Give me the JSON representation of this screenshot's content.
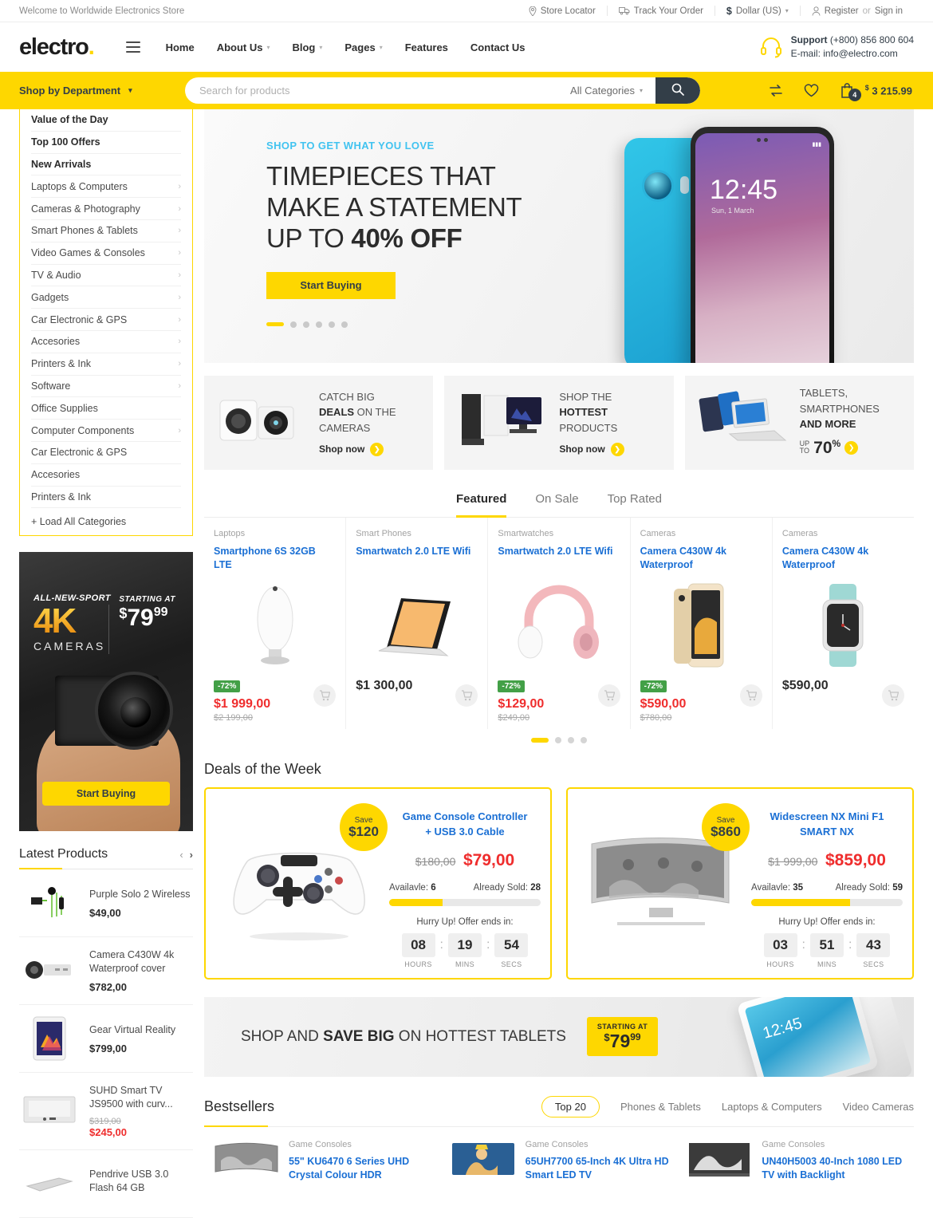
{
  "topbar": {
    "welcome": "Welcome to Worldwide Electronics Store",
    "store_locator": "Store Locator",
    "track_order": "Track Your Order",
    "currency": "Dollar (US)",
    "currency_symbol": "$",
    "register": "Register",
    "or": "or",
    "signin": "Sign in"
  },
  "header": {
    "logo": "electro",
    "logo_dot": ".",
    "nav": [
      {
        "label": "Home",
        "caret": false
      },
      {
        "label": "About Us",
        "caret": true
      },
      {
        "label": "Blog",
        "caret": true
      },
      {
        "label": "Pages",
        "caret": true
      },
      {
        "label": "Features",
        "caret": false
      },
      {
        "label": "Contact Us",
        "caret": false
      }
    ],
    "support_label": "Support",
    "support_phone": "(+800) 856 800 604",
    "support_email": "E-mail: info@electro.com"
  },
  "search": {
    "department": "Shop by Department",
    "placeholder": "Search for products",
    "value": "",
    "all_categories": "All Categories",
    "cart_count": "4",
    "cart_total": "3 215.99",
    "cart_currency": "$"
  },
  "sidebar": {
    "categories": [
      {
        "label": "Value of the Day",
        "bold": true,
        "arrow": false
      },
      {
        "label": "Top 100 Offers",
        "bold": true,
        "arrow": false
      },
      {
        "label": "New Arrivals",
        "bold": true,
        "arrow": false
      },
      {
        "label": "Laptops & Computers",
        "bold": false,
        "arrow": true
      },
      {
        "label": "Cameras & Photography",
        "bold": false,
        "arrow": true
      },
      {
        "label": "Smart Phones & Tablets",
        "bold": false,
        "arrow": true
      },
      {
        "label": "Video Games & Consoles",
        "bold": false,
        "arrow": true
      },
      {
        "label": "TV & Audio",
        "bold": false,
        "arrow": true
      },
      {
        "label": "Gadgets",
        "bold": false,
        "arrow": true
      },
      {
        "label": "Car Electronic & GPS",
        "bold": false,
        "arrow": true
      },
      {
        "label": "Accesories",
        "bold": false,
        "arrow": true
      },
      {
        "label": "Printers & Ink",
        "bold": false,
        "arrow": true
      },
      {
        "label": "Software",
        "bold": false,
        "arrow": true
      },
      {
        "label": "Office Supplies",
        "bold": false,
        "arrow": false
      },
      {
        "label": "Computer Components",
        "bold": false,
        "arrow": true
      },
      {
        "label": "Car Electronic & GPS",
        "bold": false,
        "arrow": false
      },
      {
        "label": "Accesories",
        "bold": false,
        "arrow": false
      },
      {
        "label": "Printers & Ink",
        "bold": false,
        "arrow": false
      }
    ],
    "load_all": "+ Load All Categories",
    "ad": {
      "eyebrow": "ALL-NEW-SPORT",
      "big": "4K",
      "sub": "CAMERAS",
      "starting_at": "STARTING AT",
      "currency": "$",
      "price": "79",
      "cents": "99",
      "button": "Start Buying"
    },
    "latest_title": "Latest Products",
    "latest": [
      {
        "name": "Purple Solo 2 Wireless",
        "price": "$49,00",
        "old": "",
        "sale": false,
        "icon": "earphones"
      },
      {
        "name": "Camera C430W 4k Waterproof cover",
        "price": "$782,00",
        "old": "",
        "sale": false,
        "icon": "camcorder"
      },
      {
        "name": "Gear Virtual Reality",
        "price": "$799,00",
        "old": "",
        "sale": false,
        "icon": "tablet"
      },
      {
        "name": "SUHD Smart TV JS9500 with curv...",
        "price": "$245,00",
        "old": "$319,00",
        "sale": true,
        "icon": "tv"
      },
      {
        "name": "Pendrive USB 3.0 Flash 64 GB",
        "price": "",
        "old": "",
        "sale": false,
        "icon": "usb"
      }
    ]
  },
  "hero": {
    "eyebrow": "SHOP TO GET WHAT YOU LOVE",
    "line1": "TIMEPIECES THAT",
    "line2": "MAKE A STATEMENT",
    "line3_plain": "UP TO ",
    "line3_bold": "40% OFF",
    "button": "Start Buying",
    "dots": 6,
    "active_dot": 0,
    "phone_time": "12:45",
    "phone_date": "Sun, 1 March"
  },
  "promos": [
    {
      "line1": "CATCH BIG",
      "line2_bold": "DEALS",
      "line2_rest": " ON THE",
      "line3": "CAMERAS",
      "cta": "Shop now",
      "type": "camera"
    },
    {
      "line1": "SHOP THE",
      "line2_bold": "HOTTEST",
      "line2_rest": "",
      "line3": "PRODUCTS",
      "cta": "Shop now",
      "type": "desktop"
    },
    {
      "line1": "TABLETS,",
      "line2_bold": "",
      "line2_rest": "SMARTPHONES",
      "line3": "AND MORE",
      "cta": "",
      "upto_label_1": "UP",
      "upto_label_2": "TO",
      "upto_value": "70",
      "upto_pct": "%",
      "type": "tablets"
    }
  ],
  "featured": {
    "tabs": [
      {
        "label": "Featured",
        "active": true
      },
      {
        "label": "On Sale",
        "active": false
      },
      {
        "label": "Top Rated",
        "active": false
      }
    ],
    "products": [
      {
        "category": "Laptops",
        "name": "Smartphone 6S 32GB LTE",
        "price": "$1 999,00",
        "old": "$2 199,00",
        "discount": "-72%",
        "sale": true,
        "icon": "speaker"
      },
      {
        "category": "Smart Phones",
        "name": "Smartwatch 2.0 LTE Wifi",
        "price": "$1 300,00",
        "old": "",
        "discount": "",
        "sale": false,
        "icon": "laptop"
      },
      {
        "category": "Smartwatches",
        "name": "Smartwatch 2.0 LTE Wifi",
        "price": "$129,00",
        "old": "$249,00",
        "discount": "-72%",
        "sale": true,
        "icon": "headphones"
      },
      {
        "category": "Cameras",
        "name": "Camera C430W 4k Waterproof",
        "price": "$590,00",
        "old": "$780,00",
        "discount": "-72%",
        "sale": true,
        "icon": "phone"
      },
      {
        "category": "Cameras",
        "name": "Camera C430W 4k Waterproof",
        "price": "$590,00",
        "old": "",
        "discount": "",
        "sale": false,
        "icon": "watch"
      }
    ],
    "dots": 4,
    "active_dot": 0
  },
  "deals": {
    "title": "Deals of the Week",
    "items": [
      {
        "save_label": "Save",
        "save_amount": "$120",
        "name_line1": "Game Console Controller",
        "name_line2": "+ USB 3.0 Cable",
        "old_price": "$180,00",
        "new_price": "$79,00",
        "available_label": "Availavle:",
        "available": "6",
        "sold_label": "Already Sold:",
        "sold": "28",
        "progress_pct": 35,
        "hurry": "Hurry Up! Offer ends in:",
        "hours": "08",
        "mins": "19",
        "secs": "54",
        "hours_label": "HOURS",
        "mins_label": "MINS",
        "secs_label": "SECS",
        "icon": "gamepad"
      },
      {
        "save_label": "Save",
        "save_amount": "$860",
        "name_line1": "Widescreen NX Mini F1",
        "name_line2": "SMART NX",
        "old_price": "$1 999,00",
        "new_price": "$859,00",
        "available_label": "Availavle:",
        "available": "35",
        "sold_label": "Already Sold:",
        "sold": "59",
        "progress_pct": 65,
        "hurry": "Hurry Up! Offer ends in:",
        "hours": "03",
        "mins": "51",
        "secs": "43",
        "hours_label": "HOURS",
        "mins_label": "MINS",
        "secs_label": "SECS",
        "icon": "tv"
      }
    ]
  },
  "tablet_banner": {
    "text_pre": "SHOP AND ",
    "text_bold": "SAVE BIG",
    "text_post": " ON HOTTEST TABLETS",
    "starting_at": "STARTING AT",
    "currency": "$",
    "price": "79",
    "cents": "99",
    "tab_time": "12:45"
  },
  "bestsellers": {
    "title": "Bestsellers",
    "tabs": [
      {
        "label": "Top 20",
        "active": true
      },
      {
        "label": "Phones & Tablets",
        "active": false
      },
      {
        "label": "Laptops & Computers",
        "active": false
      },
      {
        "label": "Video Cameras",
        "active": false
      }
    ],
    "products": [
      {
        "category": "Game Consoles",
        "name": "55\" KU6470 6 Series UHD Crystal Colour HDR"
      },
      {
        "category": "Game Consoles",
        "name": "65UH7700 65-Inch 4K Ultra HD Smart LED TV"
      },
      {
        "category": "Game Consoles",
        "name": "UN40H5003 40-Inch 1080 LED TV with Backlight"
      }
    ]
  },
  "colors": {
    "brand_yellow": "#fed700",
    "dark": "#333e48",
    "link_blue": "#1a6fd4",
    "sale_red": "#ef2d2d",
    "discount_green": "#43a047",
    "hero_cyan": "#41c3f0"
  }
}
